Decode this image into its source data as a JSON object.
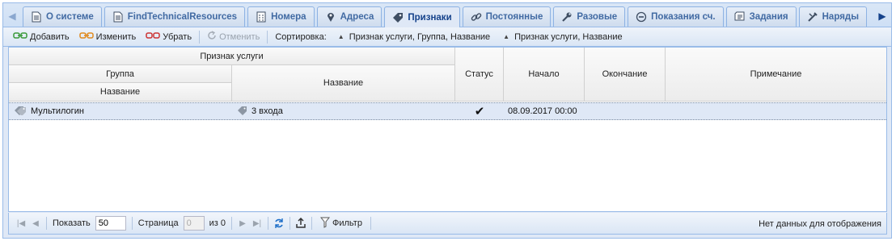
{
  "tabs": [
    {
      "label": "О системе",
      "icon": "document-icon"
    },
    {
      "label": "FindTechnicalResources",
      "icon": "document-icon"
    },
    {
      "label": "Номера",
      "icon": "phone-list-icon"
    },
    {
      "label": "Адреса",
      "icon": "map-pin-icon"
    },
    {
      "label": "Признаки",
      "icon": "tag-icon",
      "active": true
    },
    {
      "label": "Постоянные",
      "icon": "link-icon"
    },
    {
      "label": "Разовые",
      "icon": "wrench-icon"
    },
    {
      "label": "Показания сч.",
      "icon": "meter-icon"
    },
    {
      "label": "Задания",
      "icon": "task-icon"
    },
    {
      "label": "Наряды",
      "icon": "tools-icon"
    }
  ],
  "toolbar": {
    "add": "Добавить",
    "edit": "Изменить",
    "remove": "Убрать",
    "cancel": "Отменить",
    "sort_label": "Сортировка:",
    "sort_1": "Признак услуги, Группа, Название",
    "sort_2": "Признак услуги, Название"
  },
  "grid": {
    "headers": {
      "service_feature": "Признак услуги",
      "group": "Группа",
      "group_name": "Название",
      "name": "Название",
      "status": "Статус",
      "start": "Начало",
      "end": "Окончание",
      "note": "Примечание"
    },
    "rows": [
      {
        "group_name": "Мультилогин",
        "name": "3 входа",
        "status": "✔",
        "start": "08.09.2017 00:00",
        "end": "",
        "note": ""
      }
    ]
  },
  "paging": {
    "show_label": "Показать",
    "page_size": "50",
    "page_label": "Страница",
    "page_value": "0",
    "of_label": "из 0",
    "filter_label": "Фильтр",
    "info": "Нет данных для отображения"
  },
  "colors": {
    "accent": "#15428b",
    "border": "#99bbe8",
    "selected_row": "#dfe8f6"
  }
}
